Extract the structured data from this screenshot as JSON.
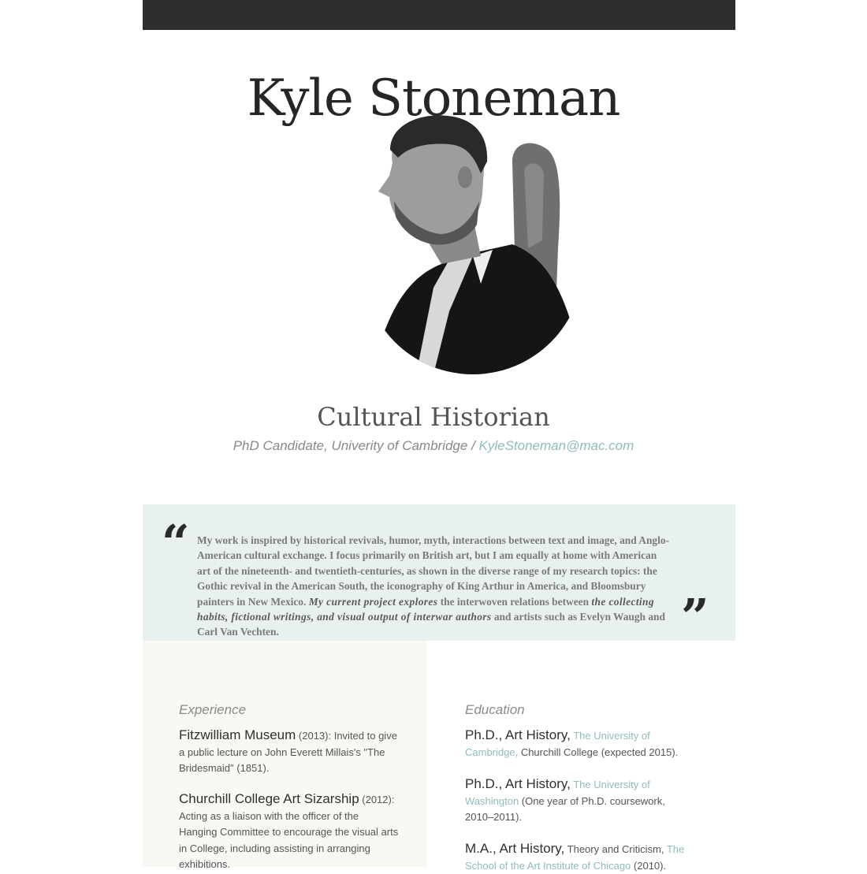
{
  "header": {
    "name": "Kyle Stoneman",
    "role": "Cultural Historian",
    "subtitle": "PhD Candidate, Univerity of Cambridge / ",
    "email": "KyleStoneman@mac.com"
  },
  "quote": {
    "open_mark": "“",
    "close_mark": "”",
    "text_plain": "My work is inspired by historical revivals, humor, myth, interactions between text and image, and Anglo-American cultural exchange. I focus primarily on British art, but I am equally at home with American art of the nineteenth- and twentieth-centuries, as shown in the diverse range of my research topics: the Gothic revival in the American South, the iconography of King Arthur in America, and Bloomsbury painters in New Mexico. ",
    "text_em1": "My current project explores",
    "text_mid": " the interwoven relations between ",
    "text_em2": "the collecting habits, fictional writings, and visual output of interwar authors",
    "text_end": " and artists such as Evelyn Waugh and Carl Van Vechten."
  },
  "experience": {
    "heading": "Experience",
    "items": [
      {
        "title": "Fitzwilliam Museum",
        "detail": " (2013): Invited to give a public lecture on John Everett Millais's \"The Bridesmaid\" (1851)."
      },
      {
        "title": "Churchill College Art Sizarship",
        "detail": " (2012): Acting as a liaison with the officer of the Hanging Committee to encourage the visual arts in College, including assisting in arranging exhibitions."
      }
    ]
  },
  "education": {
    "heading": "Education",
    "items": [
      {
        "title": "Ph.D., Art History,",
        "link": " The University of Cambridge,",
        "detail": " Churchill College (expected 2015)."
      },
      {
        "title": "Ph.D., Art History,",
        "link": " The University of Washington",
        "detail": " (One year of Ph.D. coursework, 2010–2011)."
      },
      {
        "title": "M.A., Art History,",
        "detail_pre": " Theory and Criticism, ",
        "link": "The School of the Art Institute of Chicago",
        "detail": " (2010)."
      }
    ]
  },
  "colors": {
    "topbar": "#2e2e2e",
    "accent_link": "#8fbdbb",
    "quote_band": "#e8f1f0",
    "left_column": "#faf8f2"
  },
  "icons": {
    "portrait": "portrait-photo",
    "quote_open": "open-quote-icon",
    "quote_close": "close-quote-icon"
  }
}
